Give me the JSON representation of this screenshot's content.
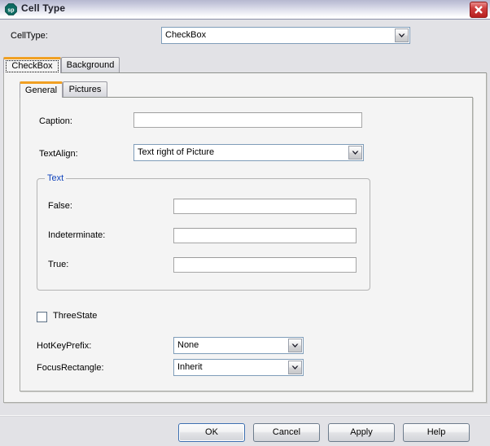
{
  "window": {
    "title": "Cell Type",
    "icon": "spread-app-icon",
    "icon_text": "sp",
    "close_label": "close-icon",
    "accent_color": "#f0a023",
    "group_legend_color": "#1144bb",
    "close_button_color": "#cf4040"
  },
  "celltype": {
    "label": "CellType:",
    "value": "CheckBox"
  },
  "outer_tabs": [
    {
      "label": "CheckBox",
      "active": true
    },
    {
      "label": "Background",
      "active": false
    }
  ],
  "inner_tabs": [
    {
      "label": "General",
      "active": true
    },
    {
      "label": "Pictures",
      "active": false
    }
  ],
  "general": {
    "caption": {
      "label": "Caption:",
      "value": "",
      "placeholder": ""
    },
    "textalign": {
      "label": "TextAlign:",
      "value": "Text right of Picture"
    },
    "text_group": {
      "legend": "Text",
      "fields": [
        {
          "label": "False:",
          "value": "",
          "placeholder": ""
        },
        {
          "label": "Indeterminate:",
          "value": "",
          "placeholder": ""
        },
        {
          "label": "True:",
          "value": "",
          "placeholder": ""
        }
      ]
    },
    "threestate": {
      "label": "ThreeState",
      "checked": false
    },
    "hotkeyprefix": {
      "label": "HotKeyPrefix:",
      "value": "None"
    },
    "focusrectangle": {
      "label": "FocusRectangle:",
      "value": "Inherit"
    }
  },
  "buttons": {
    "ok": "OK",
    "cancel": "Cancel",
    "apply": "Apply",
    "help": "Help"
  }
}
